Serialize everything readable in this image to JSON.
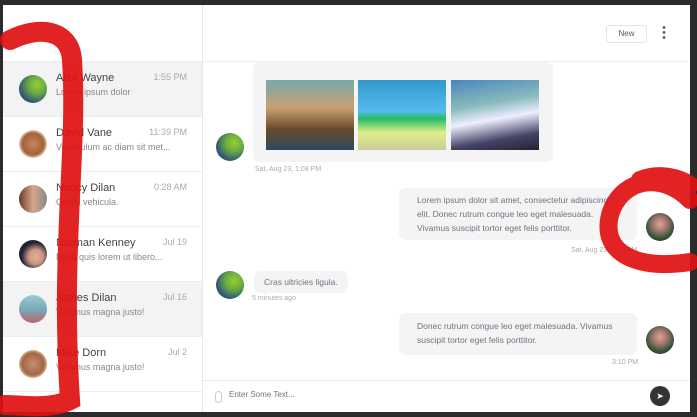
{
  "conversations": [
    {
      "name": "Alex Wayne",
      "time": "1:55 PM",
      "preview": "Lorem ipsum dolor",
      "active": true
    },
    {
      "name": "David Vane",
      "time": "11:39 PM",
      "preview": "Vestibulum ac diam sit met...",
      "active": false
    },
    {
      "name": "Nancy Dilan",
      "time": "0:28 AM",
      "preview": "Quam vehicula.",
      "active": false
    },
    {
      "name": "Norman Kenney",
      "time": "Jul 19",
      "preview": "Nulla quis lorem ut libero...",
      "active": false
    },
    {
      "name": "James Dilan",
      "time": "Jul 16",
      "preview": "Vivamus magna justo!",
      "active": true
    },
    {
      "name": "Mike Dorn",
      "time": "Jul 2",
      "preview": "Vivamus magna justo!",
      "active": false
    }
  ],
  "header": {
    "new_label": "New",
    "more_icon": "⋮"
  },
  "messages": [
    {
      "time": "Sat, Aug 23, 1:08 PM"
    },
    {
      "text": "Lorem ipsum dolor sit amet, consectetur adipiscing elit. Donec rutrum congue leo eget malesuada. Vivamus suscipit tortor eget felis porttitor.",
      "time": "Sat, Aug 23, 3:10 PM"
    },
    {
      "text": "Cras ultricies ligula.",
      "time": "5 minutes ago"
    },
    {
      "text": "Donec rutrum congue leo eget malesuada. Vivamus suscipit tortor eget felis porttitor.",
      "time": "3:10 PM"
    }
  ],
  "composer": {
    "placeholder": "Enter Some Text...",
    "send_icon": "➤"
  }
}
